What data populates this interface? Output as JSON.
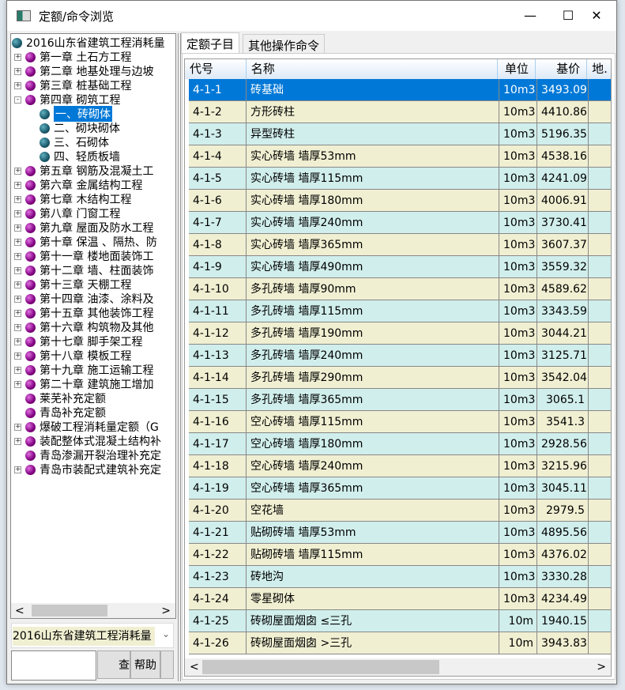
{
  "window": {
    "title": "定额/命令浏览",
    "minimize": "—",
    "maximize": "☐",
    "close": "✕"
  },
  "tree": {
    "items": [
      {
        "label": "2016山东省建筑工程消耗量",
        "level": 0,
        "icon": "teal",
        "exp": ""
      },
      {
        "label": "第一章  土石方工程",
        "level": 1,
        "icon": "purple",
        "exp": "+"
      },
      {
        "label": "第二章  地基处理与边坡",
        "level": 1,
        "icon": "purple",
        "exp": "+"
      },
      {
        "label": "第三章  桩基础工程",
        "level": 1,
        "icon": "purple",
        "exp": "+"
      },
      {
        "label": "第四章  砌筑工程",
        "level": 1,
        "icon": "purple",
        "exp": "-"
      },
      {
        "label": "一、砖砌体",
        "level": 2,
        "icon": "teal",
        "exp": "",
        "selected": true
      },
      {
        "label": "二、砌块砌体",
        "level": 2,
        "icon": "teal",
        "exp": ""
      },
      {
        "label": "三、石砌体",
        "level": 2,
        "icon": "teal",
        "exp": ""
      },
      {
        "label": "四、轻质板墙",
        "level": 2,
        "icon": "teal",
        "exp": ""
      },
      {
        "label": "第五章  钢筋及混凝土工",
        "level": 1,
        "icon": "purple",
        "exp": "+"
      },
      {
        "label": "第六章  金属结构工程",
        "level": 1,
        "icon": "purple",
        "exp": "+"
      },
      {
        "label": "第七章  木结构工程",
        "level": 1,
        "icon": "purple",
        "exp": "+"
      },
      {
        "label": "第八章  门窗工程",
        "level": 1,
        "icon": "purple",
        "exp": "+"
      },
      {
        "label": "第九章  屋面及防水工程",
        "level": 1,
        "icon": "purple",
        "exp": "+"
      },
      {
        "label": "第十章  保温 、隔热、防",
        "level": 1,
        "icon": "purple",
        "exp": "+"
      },
      {
        "label": "第十一章  楼地面装饰工",
        "level": 1,
        "icon": "purple",
        "exp": "+"
      },
      {
        "label": "第十二章  墙、柱面装饰",
        "level": 1,
        "icon": "purple",
        "exp": "+"
      },
      {
        "label": "第十三章  天棚工程",
        "level": 1,
        "icon": "purple",
        "exp": "+"
      },
      {
        "label": "第十四章  油漆、涂料及",
        "level": 1,
        "icon": "purple",
        "exp": "+"
      },
      {
        "label": "第十五章  其他装饰工程",
        "level": 1,
        "icon": "purple",
        "exp": "+"
      },
      {
        "label": "第十六章  构筑物及其他",
        "level": 1,
        "icon": "purple",
        "exp": "+"
      },
      {
        "label": "第十七章  脚手架工程",
        "level": 1,
        "icon": "purple",
        "exp": "+"
      },
      {
        "label": "第十八章  模板工程",
        "level": 1,
        "icon": "purple",
        "exp": "+"
      },
      {
        "label": "第十九章  施工运输工程",
        "level": 1,
        "icon": "purple",
        "exp": "+"
      },
      {
        "label": "第二十章  建筑施工增加",
        "level": 1,
        "icon": "purple",
        "exp": "+"
      },
      {
        "label": "莱芜补充定额",
        "level": 1,
        "icon": "purple",
        "exp": ""
      },
      {
        "label": "青岛补充定额",
        "level": 1,
        "icon": "purple",
        "exp": ""
      },
      {
        "label": "爆破工程消耗量定额（G",
        "level": 1,
        "icon": "purple",
        "exp": "+"
      },
      {
        "label": "装配整体式混凝土结构补",
        "level": 1,
        "icon": "purple",
        "exp": "+"
      },
      {
        "label": "青岛渗漏开裂治理补充定",
        "level": 1,
        "icon": "purple",
        "exp": ""
      },
      {
        "label": "青岛市装配式建筑补充定",
        "level": 1,
        "icon": "purple",
        "exp": "+"
      }
    ]
  },
  "combo": {
    "value": "2016山东省建筑工程消耗量",
    "arrow": "⌄"
  },
  "buttons": {
    "search": "查",
    "help": "帮助"
  },
  "tabs": [
    {
      "label": "定额子目"
    },
    {
      "label": "其他操作命令"
    }
  ],
  "grid": {
    "headers": [
      "代号",
      "名称",
      "单位",
      "基价",
      "地."
    ],
    "rows": [
      [
        "4-1-1",
        "砖基础",
        "10m3",
        "3493.09"
      ],
      [
        "4-1-2",
        "方形砖柱",
        "10m3",
        "4410.86"
      ],
      [
        "4-1-3",
        "异型砖柱",
        "10m3",
        "5196.35"
      ],
      [
        "4-1-4",
        "实心砖墙 墙厚53mm",
        "10m3",
        "4538.16"
      ],
      [
        "4-1-5",
        "实心砖墙 墙厚115mm",
        "10m3",
        "4241.09"
      ],
      [
        "4-1-6",
        "实心砖墙 墙厚180mm",
        "10m3",
        "4006.91"
      ],
      [
        "4-1-7",
        "实心砖墙 墙厚240mm",
        "10m3",
        "3730.41"
      ],
      [
        "4-1-8",
        "实心砖墙 墙厚365mm",
        "10m3",
        "3607.37"
      ],
      [
        "4-1-9",
        "实心砖墙 墙厚490mm",
        "10m3",
        "3559.32"
      ],
      [
        "4-1-10",
        "多孔砖墙 墙厚90mm",
        "10m3",
        "4589.62"
      ],
      [
        "4-1-11",
        "多孔砖墙 墙厚115mm",
        "10m3",
        "3343.59"
      ],
      [
        "4-1-12",
        "多孔砖墙 墙厚190mm",
        "10m3",
        "3044.21"
      ],
      [
        "4-1-13",
        "多孔砖墙 墙厚240mm",
        "10m3",
        "3125.71"
      ],
      [
        "4-1-14",
        "多孔砖墙 墙厚290mm",
        "10m3",
        "3542.04"
      ],
      [
        "4-1-15",
        "多孔砖墙 墙厚365mm",
        "10m3",
        "3065.1"
      ],
      [
        "4-1-16",
        "空心砖墙 墙厚115mm",
        "10m3",
        "3541.3"
      ],
      [
        "4-1-17",
        "空心砖墙 墙厚180mm",
        "10m3",
        "2928.56"
      ],
      [
        "4-1-18",
        "空心砖墙 墙厚240mm",
        "10m3",
        "3215.96"
      ],
      [
        "4-1-19",
        "空心砖墙 墙厚365mm",
        "10m3",
        "3045.11"
      ],
      [
        "4-1-20",
        "空花墙",
        "10m3",
        "2979.5"
      ],
      [
        "4-1-21",
        "贴砌砖墙 墙厚53mm",
        "10m3",
        "4895.56"
      ],
      [
        "4-1-22",
        "贴砌砖墙 墙厚115mm",
        "10m3",
        "4376.02"
      ],
      [
        "4-1-23",
        "砖地沟",
        "10m3",
        "3330.28"
      ],
      [
        "4-1-24",
        "零星砌体",
        "10m3",
        "4234.49"
      ],
      [
        "4-1-25",
        "砖砌屋面烟囱 ≤三孔",
        "10m",
        "1940.15"
      ],
      [
        "4-1-26",
        "砖砌屋面烟囱 >三孔",
        "10m",
        "3943.83"
      ]
    ]
  },
  "scroll": {
    "left": "<",
    "right": ">"
  }
}
